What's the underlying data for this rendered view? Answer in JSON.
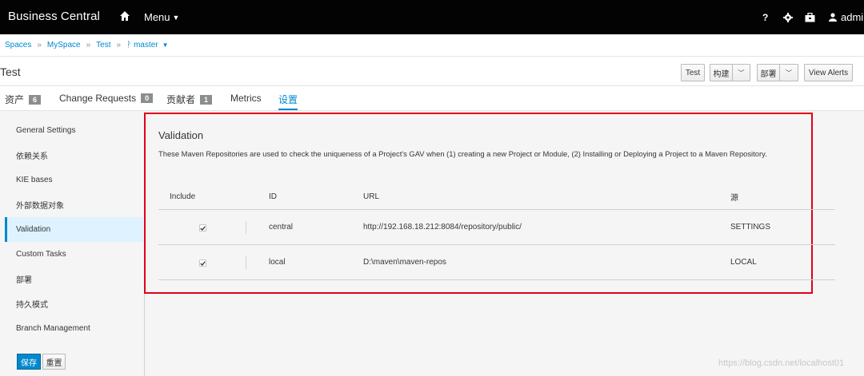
{
  "topbar": {
    "brand": "Business Central",
    "menu_label": "Menu",
    "help_label": "?",
    "user_label": "admin"
  },
  "breadcrumb": {
    "items": [
      "Spaces",
      "MySpace",
      "Test"
    ],
    "separator": "»",
    "branch": "master"
  },
  "project": {
    "title": "Test",
    "buttons": {
      "test": "Test",
      "build": "构建",
      "deploy": "部署",
      "view_alerts": "View Alerts"
    }
  },
  "tabs": [
    {
      "label": "资产",
      "badge": "6"
    },
    {
      "label": "Change Requests",
      "badge": "0"
    },
    {
      "label": "贡献者",
      "badge": "1"
    },
    {
      "label": "Metrics"
    },
    {
      "label": "设置",
      "active": true
    }
  ],
  "sidebar": {
    "items": [
      {
        "label": "General Settings"
      },
      {
        "label": "依赖关系"
      },
      {
        "label": "KIE bases"
      },
      {
        "label": "外部数据对象"
      },
      {
        "label": "Validation",
        "active": true
      },
      {
        "label": "Custom Tasks"
      },
      {
        "label": "部署"
      },
      {
        "label": "持久模式"
      },
      {
        "label": "Branch Management"
      }
    ],
    "save_label": "保存",
    "reset_label": "重置"
  },
  "validation": {
    "title": "Validation",
    "description": "These Maven Repositories are used to check the uniqueness of a Project's GAV when (1) creating a new Project or Module, (2) Installing or Deploying a Project to a Maven Repository.",
    "columns": {
      "include": "Include",
      "id": "ID",
      "url": "URL",
      "source": "源"
    },
    "rows": [
      {
        "include": true,
        "id": "central",
        "url": "http://192.168.18.212:8084/repository/public/",
        "source": "SETTINGS"
      },
      {
        "include": true,
        "id": "local",
        "url": "D:\\maven\\maven-repos",
        "source": "LOCAL"
      }
    ]
  },
  "watermark": "https://blog.csdn.net/localhost01",
  "colors": {
    "accent": "#0088ce",
    "highlight_border": "#e0001a",
    "topbar": "#030303"
  }
}
